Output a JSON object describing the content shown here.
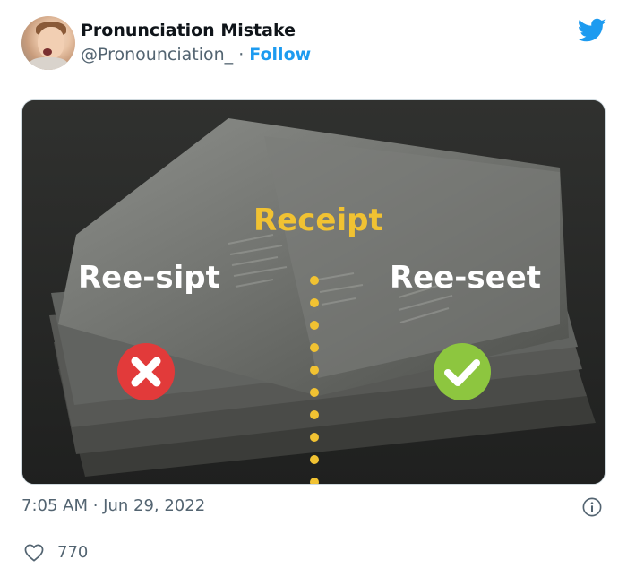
{
  "author": {
    "display_name": "Pronunciation Mistake",
    "handle": "@Pronounciation_",
    "separator": " · ",
    "follow_label": "Follow"
  },
  "media": {
    "word": "Receipt",
    "wrong_pronunciation": "Ree-sipt",
    "right_pronunciation": "Ree-seet",
    "wrong_marker_icon": "x-icon",
    "right_marker_icon": "check-icon"
  },
  "footer": {
    "timestamp": "7:05 AM · Jun 29, 2022",
    "like_count": "770"
  },
  "colors": {
    "brand_blue": "#1d9bf0",
    "receipt_yellow": "#f1c232",
    "wrong_red": "#e23a3a",
    "right_green": "#8dc63f",
    "muted_text": "#536471"
  }
}
